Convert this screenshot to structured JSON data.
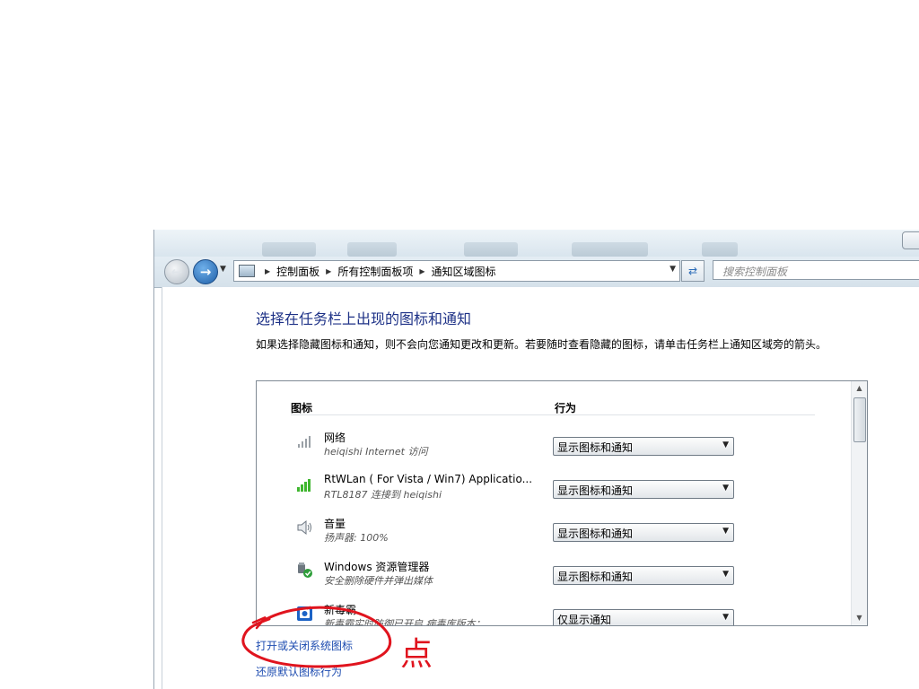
{
  "nav": {
    "breadcrumb": [
      "控制面板",
      "所有控制面板项",
      "通知区域图标"
    ],
    "search_placeholder": "搜索控制面板"
  },
  "main": {
    "heading": "选择在任务栏上出现的图标和通知",
    "description": "如果选择隐藏图标和通知，则不会向您通知更改和更新。若要随时查看隐藏的图标，请单击任务栏上通知区域旁的箭头。",
    "columns": {
      "icon": "图标",
      "behavior": "行为"
    },
    "rows": [
      {
        "name": "网络",
        "sub": "heiqishi Internet 访问",
        "behavior": "显示图标和通知",
        "icon": "network-icon"
      },
      {
        "name": "RtWLan ( For Vista / Win7) Applicatio...",
        "sub": "RTL8187 连接到 heiqishi",
        "behavior": "显示图标和通知",
        "icon": "wireless-signal-icon"
      },
      {
        "name": "音量",
        "sub": "扬声器: 100%",
        "behavior": "显示图标和通知",
        "icon": "speaker-icon"
      },
      {
        "name": "Windows 资源管理器",
        "sub": "安全删除硬件并弹出媒体",
        "behavior": "显示图标和通知",
        "icon": "usb-eject-icon"
      },
      {
        "name": "新毒霸",
        "sub": "新毒霸实时防御已开启 病毒库版本：...",
        "behavior": "仅显示通知",
        "icon": "antivirus-icon"
      }
    ],
    "links": {
      "system_icons": "打开或关闭系统图标",
      "restore_defaults": "还原默认图标行为"
    }
  },
  "annotation": {
    "note": "点",
    "color": "#e0141e"
  }
}
